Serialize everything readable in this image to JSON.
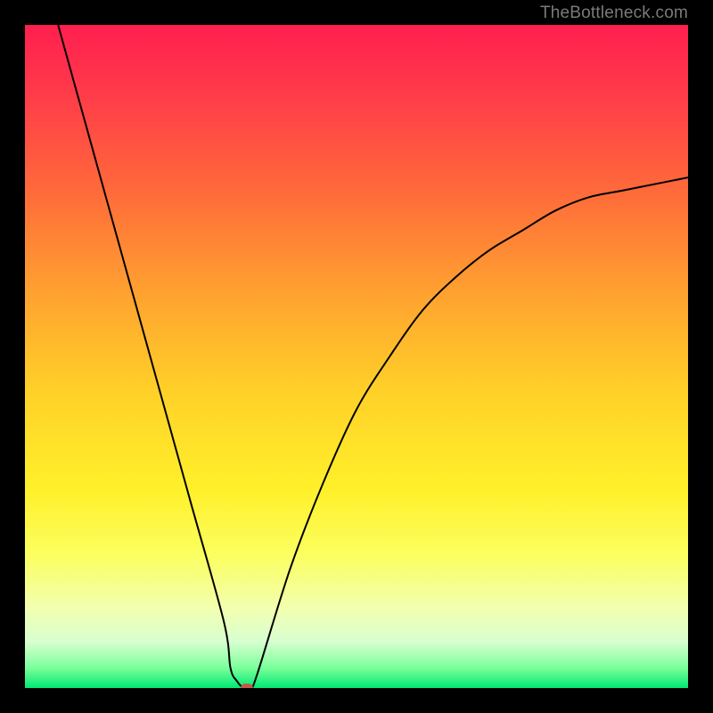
{
  "watermark": "TheBottleneck.com",
  "chart_data": {
    "type": "line",
    "title": "",
    "xlabel": "",
    "ylabel": "",
    "xlim": [
      0,
      100
    ],
    "ylim": [
      0,
      100
    ],
    "grid": false,
    "series": [
      {
        "name": "bottleneck-curve",
        "x": [
          5,
          10,
          15,
          20,
          25,
          30,
          31,
          32,
          33,
          34,
          35,
          40,
          45,
          50,
          55,
          60,
          65,
          70,
          75,
          80,
          85,
          90,
          95,
          100
        ],
        "y": [
          100,
          82,
          64,
          46,
          28,
          10,
          3,
          1,
          0,
          0,
          2,
          18,
          31,
          42,
          50,
          57,
          62,
          66,
          69,
          72,
          74,
          75,
          76,
          77
        ]
      }
    ],
    "marker": {
      "x": 33.5,
      "y": 0,
      "color": "#c05a4a"
    },
    "gradient_stops": [
      {
        "offset": 0.0,
        "color": "#ff1f4f"
      },
      {
        "offset": 0.1,
        "color": "#ff3a4a"
      },
      {
        "offset": 0.25,
        "color": "#ff6a3a"
      },
      {
        "offset": 0.4,
        "color": "#ffa030"
      },
      {
        "offset": 0.55,
        "color": "#ffd028"
      },
      {
        "offset": 0.7,
        "color": "#fff02a"
      },
      {
        "offset": 0.8,
        "color": "#fbff60"
      },
      {
        "offset": 0.88,
        "color": "#f2ffb0"
      },
      {
        "offset": 0.93,
        "color": "#d8ffd0"
      },
      {
        "offset": 0.97,
        "color": "#7aff9a"
      },
      {
        "offset": 1.0,
        "color": "#00e874"
      }
    ]
  }
}
